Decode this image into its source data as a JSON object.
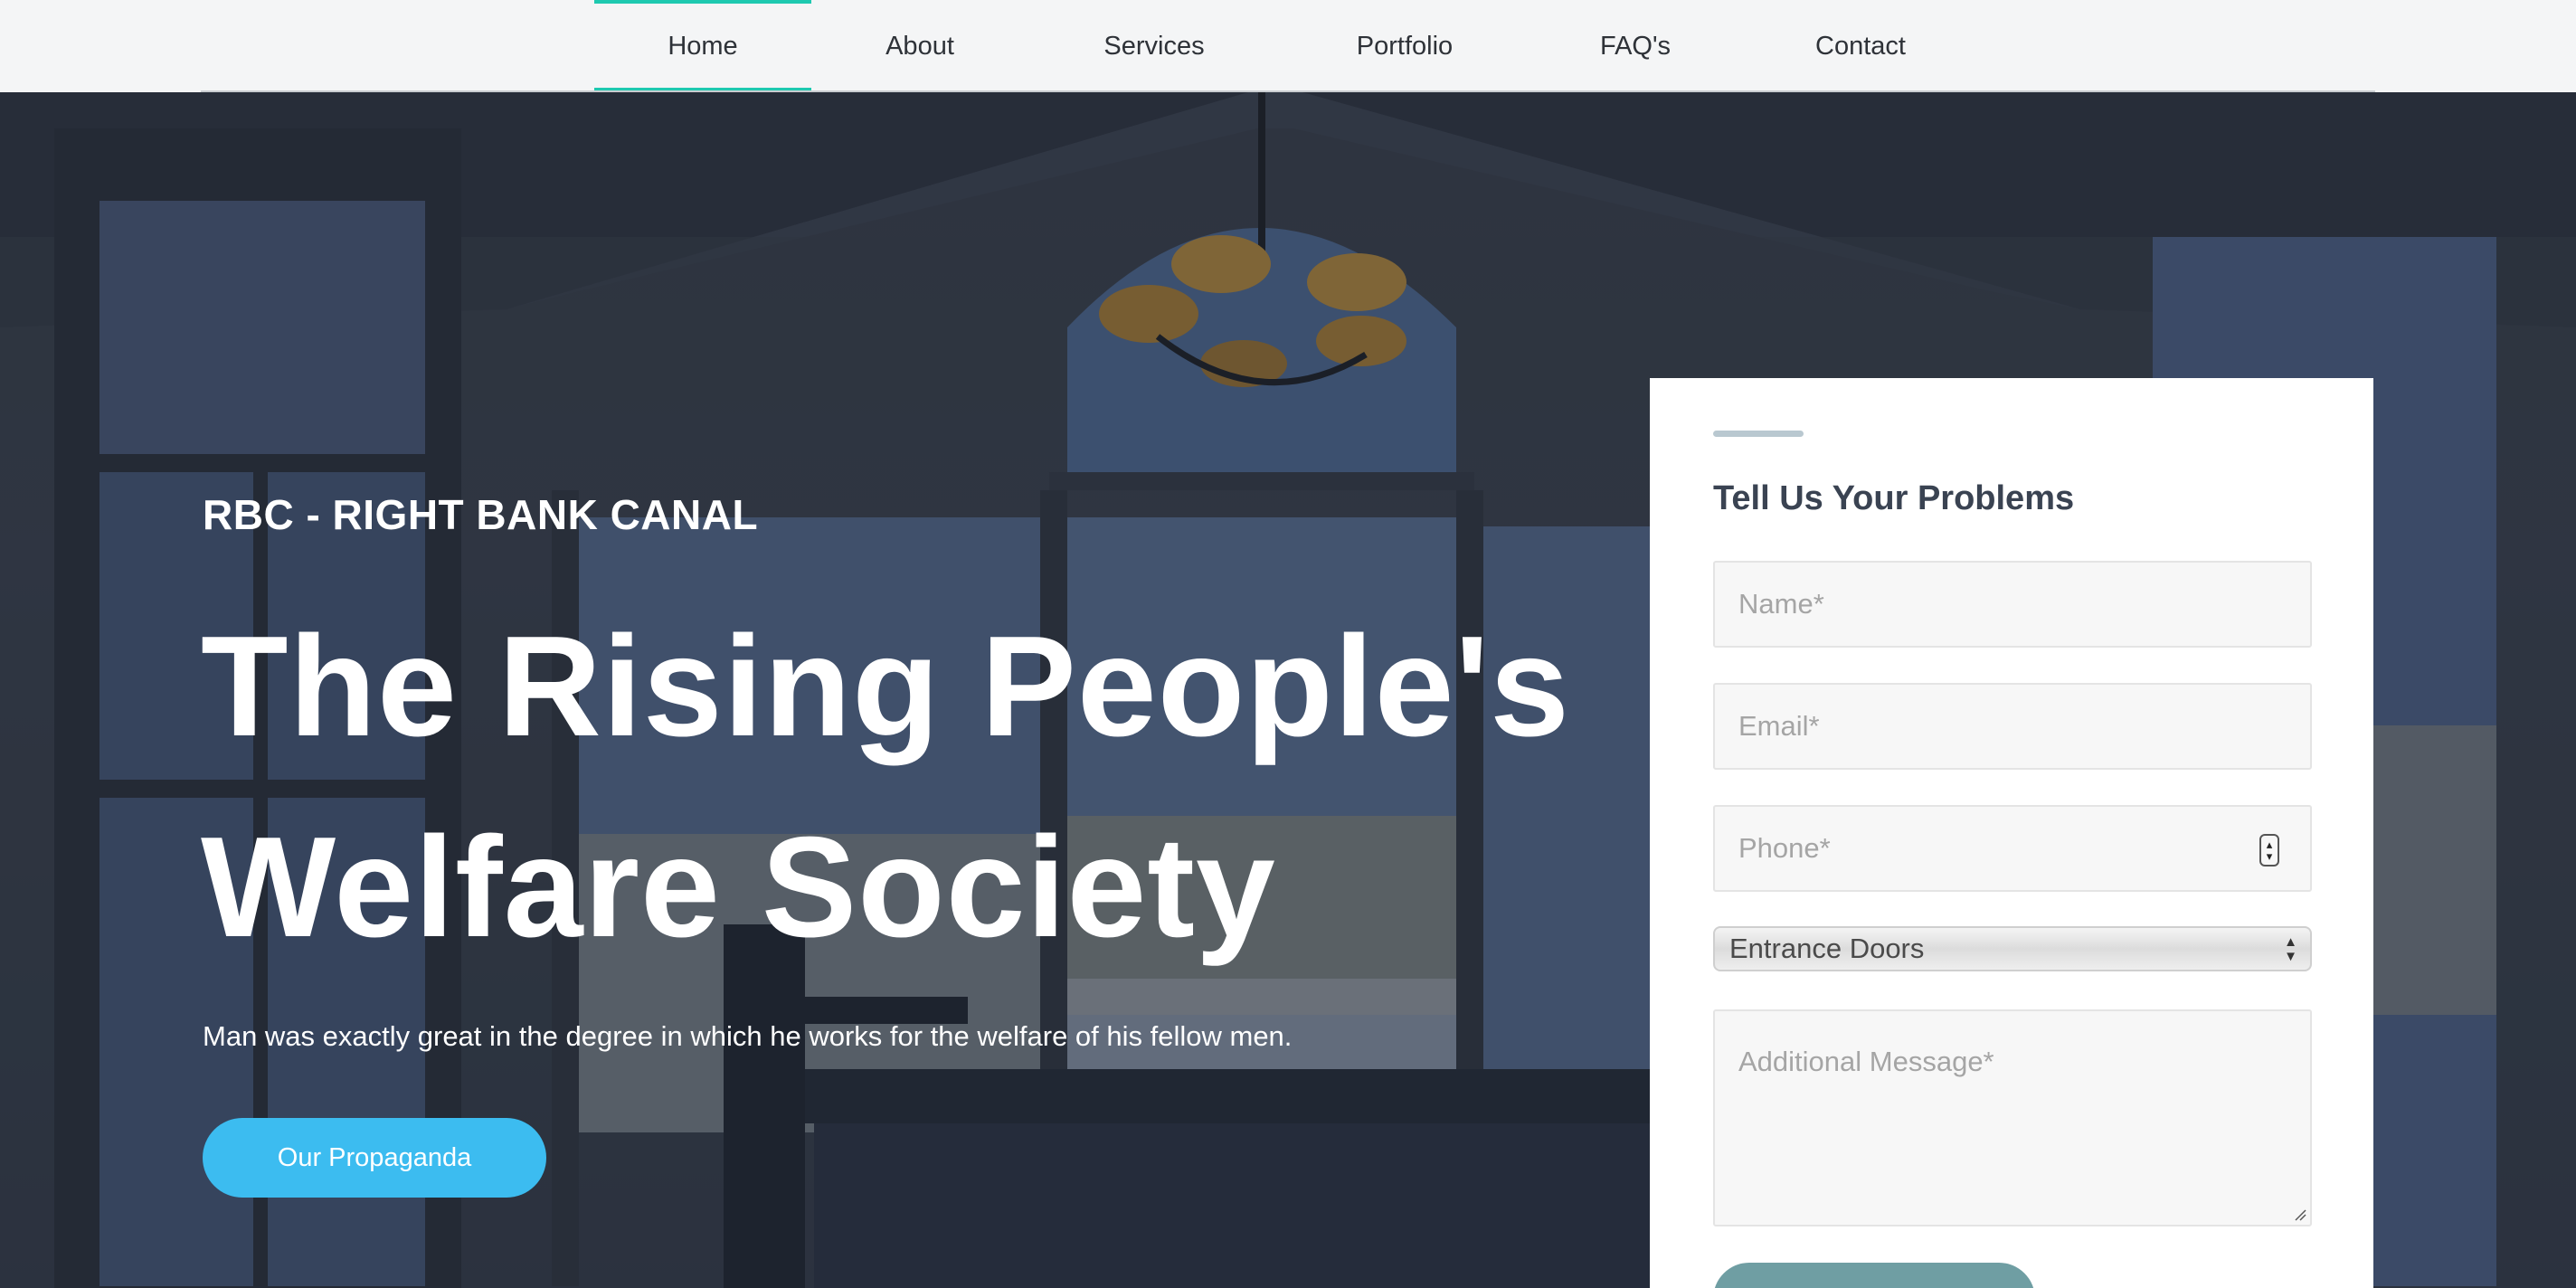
{
  "nav": {
    "items": [
      {
        "label": "Home",
        "active": true
      },
      {
        "label": "About",
        "active": false
      },
      {
        "label": "Services",
        "active": false
      },
      {
        "label": "Portfolio",
        "active": false
      },
      {
        "label": "FAQ's",
        "active": false
      },
      {
        "label": "Contact",
        "active": false
      }
    ],
    "accent_color": "#1ec9b0"
  },
  "hero": {
    "kicker": "RBC - RIGHT BANK CANAL",
    "headline_line1": "The Rising People's",
    "headline_line2": "Welfare Society",
    "lead": "Man was exactly great in the degree in which he works for the welfare of his fellow men.",
    "cta_label": "Our Propaganda",
    "cta_color": "#3cbcf0"
  },
  "form": {
    "title": "Tell Us Your Problems",
    "name_placeholder": "Name*",
    "email_placeholder": "Email*",
    "phone_placeholder": "Phone*",
    "select_value": "Entrance Doors",
    "message_placeholder": "Additional Message*"
  }
}
